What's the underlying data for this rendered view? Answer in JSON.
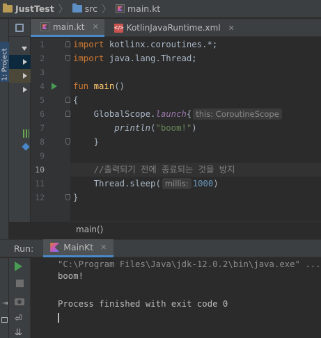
{
  "navbar": {
    "project": "JustTest",
    "src": "src",
    "file": "main.kt"
  },
  "left_strip": {
    "project_label": "1: Project"
  },
  "tabs": [
    {
      "label": "main.kt",
      "active": true
    },
    {
      "label": "KotlinJavaRuntime.xml",
      "active": false
    }
  ],
  "editor": {
    "line_numbers": [
      "1",
      "2",
      "3",
      "4",
      "5",
      "6",
      "7",
      "8",
      "9",
      "10",
      "11",
      "12"
    ],
    "current_line": "10",
    "lines": {
      "l1_kw": "import",
      "l1_rest": " kotlinx.coroutines.*;",
      "l2_kw": "import",
      "l2_rest": " java.lang.Thread;",
      "l4_kw": "fun",
      "l4_fn": "main",
      "l4_rest": "()",
      "l5": "{",
      "l6_a": "    GlobalScope.",
      "l6_b": "launch",
      "l6_c": "{",
      "l6_hint": "this: CoroutineScope",
      "l7_indent": "        ",
      "l7_fn": "println",
      "l7_open": "(",
      "l7_str": "\"boom!\"",
      "l7_close": ")",
      "l8": "    }",
      "l10": "    //출력되기 전에 종료되는 것을 방지",
      "l11_a": "    Thread.sleep(",
      "l11_hint": "millis:",
      "l11_num": "1000",
      "l11_close": ")",
      "l12": "}"
    }
  },
  "breadcrumb": {
    "label": "main()"
  },
  "run": {
    "title": "Run:",
    "tab_label": "MainKt",
    "console": [
      "\"C:\\Program Files\\Java\\jdk-12.0.2\\bin\\java.exe\" ...",
      "boom!",
      "",
      "Process finished with exit code 0"
    ]
  },
  "colors": {
    "background": "#2b2b2b",
    "keyword": "#cc7832",
    "function": "#ffc66d",
    "string": "#6a8759",
    "number": "#6897bb",
    "comment": "#808080",
    "run_green": "#499c54",
    "tab_accent": "#4a88c7"
  },
  "icons": [
    "folder-icon",
    "kotlin-file-icon",
    "xml-file-icon",
    "run-icon",
    "stop-icon",
    "camera-icon",
    "soft-wrap-icon",
    "scroll-to-end-icon",
    "print-icon"
  ]
}
